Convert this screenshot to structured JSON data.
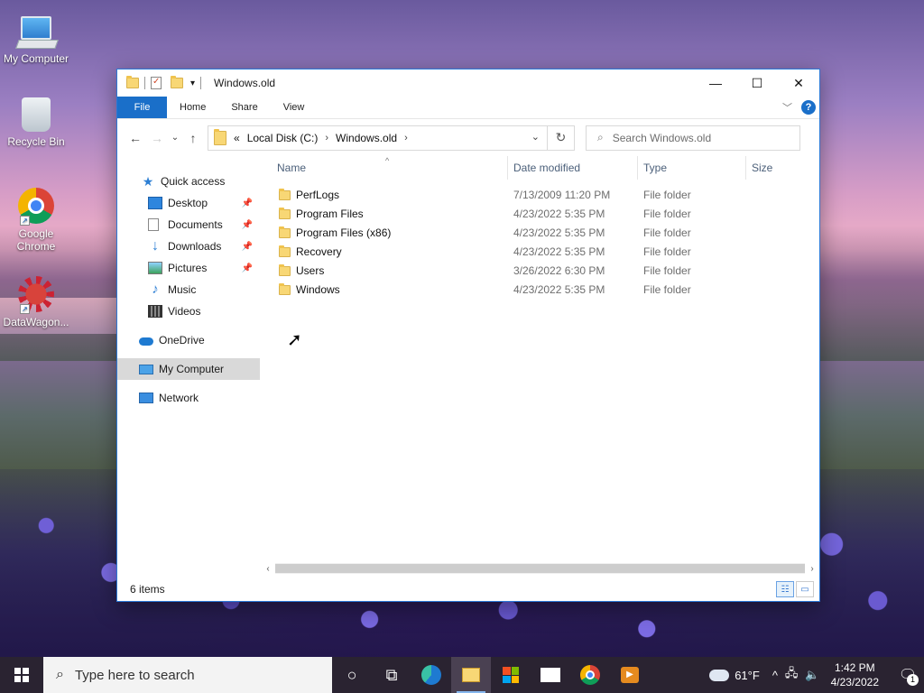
{
  "desktop": {
    "icons": [
      {
        "label": "My Computer",
        "icon": "computer-icon"
      },
      {
        "label": "Recycle Bin",
        "icon": "recycle-bin-icon"
      },
      {
        "label": "Google Chrome",
        "icon": "chrome-icon"
      },
      {
        "label": "DataWagon...",
        "icon": "datawagon-icon"
      }
    ]
  },
  "window": {
    "title": "Windows.old",
    "controls": {
      "minimize": "—",
      "maximize": "☐",
      "close": "✕"
    },
    "ribbon": {
      "tabs": [
        "File",
        "Home",
        "Share",
        "View"
      ],
      "help": "?"
    },
    "address": {
      "overflow": "«",
      "crumbs": [
        "Local Disk (C:)",
        "Windows.old"
      ],
      "separator": "›"
    },
    "search": {
      "placeholder": "Search Windows.old"
    },
    "navpane": {
      "quick_access": "Quick access",
      "pinned": [
        {
          "label": "Desktop",
          "icon": "desktop-icon",
          "pinned": true
        },
        {
          "label": "Documents",
          "icon": "documents-icon",
          "pinned": true
        },
        {
          "label": "Downloads",
          "icon": "downloads-icon",
          "pinned": true
        },
        {
          "label": "Pictures",
          "icon": "pictures-icon",
          "pinned": true
        },
        {
          "label": "Music",
          "icon": "music-icon",
          "pinned": false
        },
        {
          "label": "Videos",
          "icon": "videos-icon",
          "pinned": false
        }
      ],
      "onedrive": "OneDrive",
      "this_pc": "My Computer",
      "network": "Network"
    },
    "columns": {
      "name": "Name",
      "date": "Date modified",
      "type": "Type",
      "size": "Size"
    },
    "files": [
      {
        "name": "PerfLogs",
        "date": "7/13/2009 11:20 PM",
        "type": "File folder"
      },
      {
        "name": "Program Files",
        "date": "4/23/2022 5:35 PM",
        "type": "File folder"
      },
      {
        "name": "Program Files (x86)",
        "date": "4/23/2022 5:35 PM",
        "type": "File folder"
      },
      {
        "name": "Recovery",
        "date": "4/23/2022 5:35 PM",
        "type": "File folder"
      },
      {
        "name": "Users",
        "date": "3/26/2022 6:30 PM",
        "type": "File folder"
      },
      {
        "name": "Windows",
        "date": "4/23/2022 5:35 PM",
        "type": "File folder"
      }
    ],
    "status": "6 items"
  },
  "taskbar": {
    "search_placeholder": "Type here to search",
    "weather": "61°F",
    "time": "1:42 PM",
    "date": "4/23/2022",
    "notifications": "1"
  },
  "colors": {
    "accent": "#1a6fc9",
    "window_border": "#2b78d6",
    "taskbar": "#2a2331",
    "folder": "#f8d775"
  }
}
